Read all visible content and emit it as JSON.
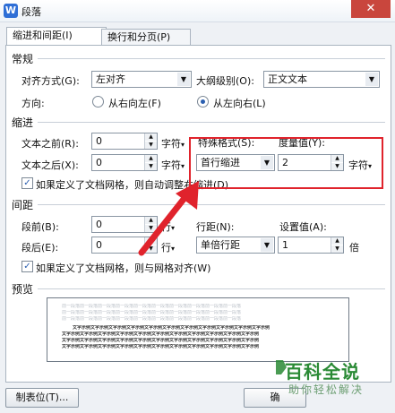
{
  "window": {
    "title": "段落",
    "app_icon_letter": "W",
    "close_glyph": "✕"
  },
  "tabs": [
    {
      "label": "缩进和间距(I)",
      "active": true
    },
    {
      "label": "换行和分页(P)",
      "active": false
    }
  ],
  "general": {
    "section_title": "常规",
    "alignment_label": "对齐方式(G):",
    "alignment_value": "左对齐",
    "outline_label": "大纲级别(O):",
    "outline_value": "正文文本",
    "direction_label": "方向:",
    "rtl_label": "从右向左(F)",
    "ltr_label": "从左向右(L)",
    "direction_selected": "ltr"
  },
  "indent": {
    "section_title": "缩进",
    "before_label": "文本之前(R):",
    "before_value": "0",
    "before_unit": "字符",
    "after_label": "文本之后(X):",
    "after_value": "0",
    "after_unit": "字符",
    "special_label": "特殊格式(S):",
    "special_value": "首行缩进",
    "measure_label": "度量值(Y):",
    "measure_value": "2",
    "measure_unit": "字符",
    "auto_adjust_label": "如果定义了文档网格，则自动调整右缩进(D)",
    "auto_adjust_checked": true
  },
  "spacing": {
    "section_title": "间距",
    "before_label": "段前(B):",
    "before_value": "0",
    "before_unit": "行",
    "after_label": "段后(E):",
    "after_value": "0",
    "after_unit": "行",
    "line_label": "行距(N):",
    "line_value": "单倍行距",
    "setting_label": "设置值(A):",
    "setting_value": "1",
    "setting_unit": "倍",
    "grid_align_label": "如果定义了文档网格，则与网格对齐(W)",
    "grid_align_checked": true
  },
  "preview": {
    "section_title": "预览",
    "prev_text": "前一段落前一段落前一段落前一段落前一段落前一段落前一段落前一段落前一段落前一段落",
    "sample_text": "文字示例文字示例文字示例文字示例文字示例文字示例文字示例文字示例文字示例文字示例文字示例"
  },
  "buttons": {
    "tabs_label": "制表位(T)...",
    "ok_label": "确"
  },
  "watermark": {
    "title": "百科全说",
    "subtitle": "助你轻松解决"
  },
  "colors": {
    "highlight": "#e0232c",
    "arrow": "#e0232c",
    "watermark": "#2a8a35"
  }
}
